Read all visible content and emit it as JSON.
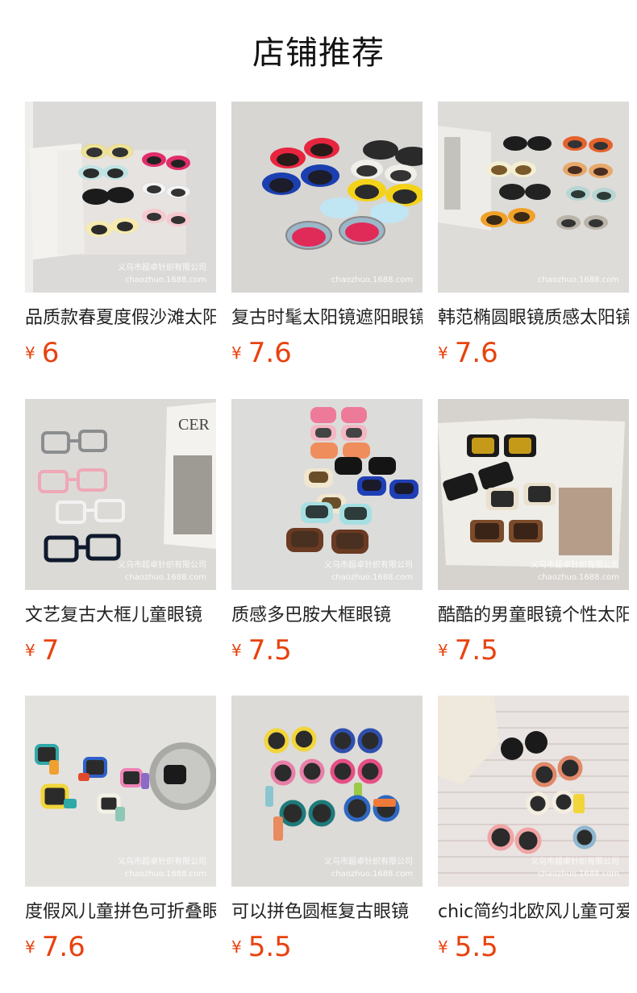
{
  "header": {
    "title": "店铺推荐"
  },
  "products": [
    {
      "title": "品质款春夏度假沙滩太阳镜",
      "currency": "¥",
      "price": "6",
      "watermark_line1": "义乌市超卓针织有限公司",
      "watermark_line2": "chaozhuo.1688.com"
    },
    {
      "title": "复古时髦太阳镜遮阳眼镜",
      "currency": "¥",
      "price": "7.6",
      "watermark_line1": "",
      "watermark_line2": "chaozhuo.1688.com"
    },
    {
      "title": "韩范椭圆眼镜质感太阳镜",
      "currency": "¥",
      "price": "7.6",
      "watermark_line1": "",
      "watermark_line2": "chaozhuo.1688.com"
    },
    {
      "title": "文艺复古大框儿童眼镜",
      "currency": "¥",
      "price": "7",
      "watermark_line1": "义乌市超卓针织有限公司",
      "watermark_line2": "chaozhuo.1688.com"
    },
    {
      "title": "质感多巴胺大框眼镜",
      "currency": "¥",
      "price": "7.5",
      "watermark_line1": "义乌市超卓针织有限公司",
      "watermark_line2": "chaozhuo.1688.com"
    },
    {
      "title": "酷酷的男童眼镜个性太阳镜",
      "currency": "¥",
      "price": "7.5",
      "watermark_line1": "义乌市超卓针织有限公司",
      "watermark_line2": "chaozhuo.1688.com"
    },
    {
      "title": "度假风儿童拼色可折叠眼镜",
      "currency": "¥",
      "price": "7.6",
      "watermark_line1": "义乌市超卓针织有限公司",
      "watermark_line2": "chaozhuo.1688.com"
    },
    {
      "title": "可以拼色圆框复古眼镜",
      "currency": "¥",
      "price": "5.5",
      "watermark_line1": "义乌市超卓针织有限公司",
      "watermark_line2": "chaozhuo.1688.com"
    },
    {
      "title": "chic简约北欧风儿童可爱眼镜",
      "currency": "¥",
      "price": "5.5",
      "watermark_line1": "义乌市超卓针织有限公司",
      "watermark_line2": "chaozhuo.1688.com"
    }
  ],
  "colors": {
    "price": "#e8420f",
    "title": "#222222",
    "header": "#111111"
  }
}
